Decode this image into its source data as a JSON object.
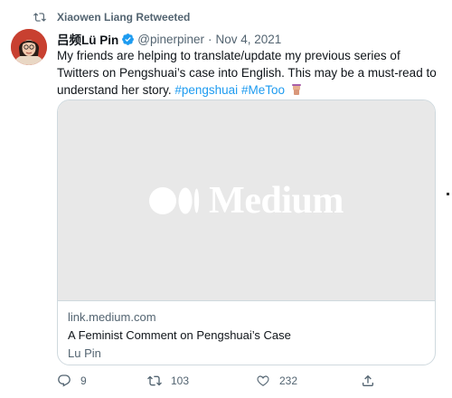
{
  "retweet": {
    "label": "Xiaowen Liang Retweeted",
    "icon": "retweet-icon"
  },
  "tweet": {
    "author_name": "吕频Lü Pin",
    "verified": true,
    "handle": "@pinerpiner",
    "separator": "·",
    "date": "Nov 4, 2021",
    "text": "My friends are helping to translate/update my previous series of Twitters on Pengshuai’s case into English.  This may be a must-read to understand her story.",
    "hashtags": [
      "#pengshuai",
      "#MeToo"
    ]
  },
  "card": {
    "image_brand": "Medium",
    "domain": "link.medium.com",
    "title": "A Feminist Comment on Pengshuai’s Case",
    "author": "Lu Pin"
  },
  "actions": {
    "reply_count": "9",
    "retweet_count": "103",
    "like_count": "232"
  },
  "colors": {
    "accent": "#1d9bf0",
    "muted": "#536471",
    "text": "#0f1419",
    "border": "#cfd9de",
    "card_image_bg": "#e8e8e8"
  }
}
